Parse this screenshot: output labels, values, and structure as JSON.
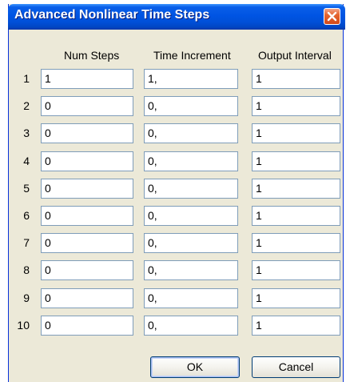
{
  "window": {
    "title": "Advanced Nonlinear Time Steps"
  },
  "columns": [
    "Num Steps",
    "Time Increment",
    "Output Interval"
  ],
  "rows": [
    {
      "num": "1",
      "num_steps": "1",
      "time_increment": "1,",
      "output_interval": "1"
    },
    {
      "num": "2",
      "num_steps": "0",
      "time_increment": "0,",
      "output_interval": "1"
    },
    {
      "num": "3",
      "num_steps": "0",
      "time_increment": "0,",
      "output_interval": "1"
    },
    {
      "num": "4",
      "num_steps": "0",
      "time_increment": "0,",
      "output_interval": "1"
    },
    {
      "num": "5",
      "num_steps": "0",
      "time_increment": "0,",
      "output_interval": "1"
    },
    {
      "num": "6",
      "num_steps": "0",
      "time_increment": "0,",
      "output_interval": "1"
    },
    {
      "num": "7",
      "num_steps": "0",
      "time_increment": "0,",
      "output_interval": "1"
    },
    {
      "num": "8",
      "num_steps": "0",
      "time_increment": "0,",
      "output_interval": "1"
    },
    {
      "num": "9",
      "num_steps": "0",
      "time_increment": "0,",
      "output_interval": "1"
    },
    {
      "num": "10",
      "num_steps": "0",
      "time_increment": "0,",
      "output_interval": "1"
    }
  ],
  "buttons": {
    "ok": "OK",
    "cancel": "Cancel"
  },
  "icons": {
    "close": "close-icon"
  },
  "colors": {
    "titlebar": "#0054E3",
    "dialog_bg": "#ECE9D8",
    "field_border": "#7F9DB9",
    "close_button": "#E5652F"
  }
}
